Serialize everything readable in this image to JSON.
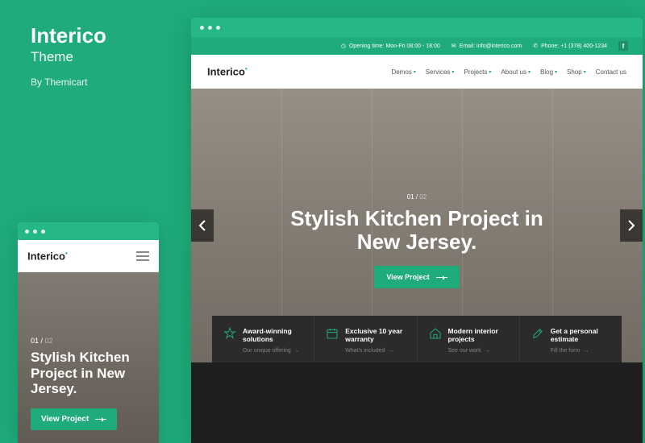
{
  "promo": {
    "title": "Interico",
    "subtitle": "Theme",
    "byline": "By Themicart"
  },
  "logo": "Interico",
  "mobile": {
    "pager_current": "01",
    "pager_sep": " / ",
    "pager_total": "02",
    "headline": "Stylish Kitchen Project in New Jersey.",
    "cta": "View Project"
  },
  "desktop": {
    "topbar": {
      "hours": "Opening time: Mon-Fri 08:00 - 18:00",
      "email": "Email: info@interico.com",
      "phone": "Phone: +1 (378) 400-1234",
      "social": "f"
    },
    "nav": [
      "Demos",
      "Services",
      "Projects",
      "About us",
      "Blog",
      "Shop",
      "Contact us"
    ],
    "hero": {
      "pager_current": "01",
      "pager_sep": " / ",
      "pager_total": "02",
      "headline_l1": "Stylish Kitchen Project in",
      "headline_l2": "New Jersey.",
      "cta": "View Project"
    },
    "features": [
      {
        "title": "Award-winning solutions",
        "link": "Our unique offering",
        "icon": "star"
      },
      {
        "title": "Exclusive 10 year warranty",
        "link": "What's included",
        "icon": "calendar"
      },
      {
        "title": "Modern interior projects",
        "link": "See our work",
        "icon": "house"
      },
      {
        "title": "Get a personal estimate",
        "link": "Fill the form",
        "icon": "pencil"
      }
    ]
  },
  "colors": {
    "accent": "#1fab7a"
  }
}
